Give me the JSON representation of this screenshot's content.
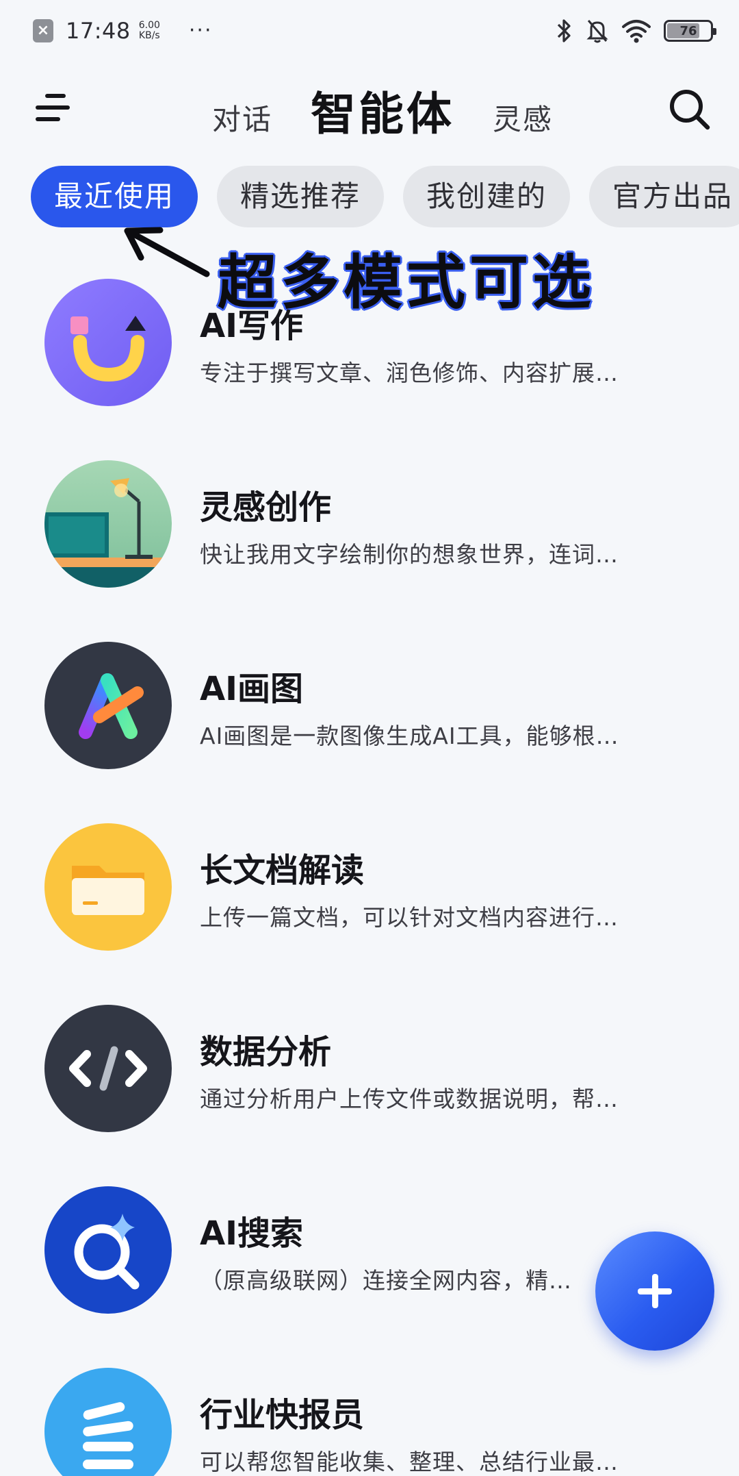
{
  "status_bar": {
    "time": "17:48",
    "net_speed_value": "6.00",
    "net_speed_unit": "KB/s",
    "more": "···",
    "battery": "76",
    "battery_level": 0.76,
    "icons": [
      "close-notification-icon",
      "bluetooth-icon",
      "mute-bell-icon",
      "wifi-icon",
      "battery-icon"
    ]
  },
  "header": {
    "tabs": [
      {
        "label": "对话",
        "active": false
      },
      {
        "label": "智能体",
        "active": true
      },
      {
        "label": "灵感",
        "active": false
      }
    ],
    "icons": [
      "menu-icon",
      "search-icon"
    ]
  },
  "chips": [
    {
      "label": "最近使用",
      "active": true
    },
    {
      "label": "精选推荐",
      "active": false
    },
    {
      "label": "我创建的",
      "active": false
    },
    {
      "label": "官方出品",
      "active": false
    }
  ],
  "annotation": {
    "text": "超多模式可选",
    "color": "#3a5ff0"
  },
  "agents": [
    {
      "title": "AI写作",
      "desc": "专注于撰写文章、润色修饰、内容扩展…",
      "icon": "writing-smile-icon"
    },
    {
      "title": "灵感创作",
      "desc": "快让我用文字绘制你的想象世界，连词…",
      "icon": "desk-lamp-scene-icon"
    },
    {
      "title": "AI画图",
      "desc": "AI画图是一款图像生成AI工具，能够根…",
      "icon": "gradient-a-logo-icon"
    },
    {
      "title": "长文档解读",
      "desc": "上传一篇文档，可以针对文档内容进行…",
      "icon": "folder-icon"
    },
    {
      "title": "数据分析",
      "desc": "通过分析用户上传文件或数据说明，帮…",
      "icon": "code-brackets-icon"
    },
    {
      "title": "AI搜索",
      "desc": "（原高级联网）连接全网内容，精…",
      "icon": "sparkle-search-icon"
    },
    {
      "title": "行业快报员",
      "desc": "可以帮您智能收集、整理、总结行业最…",
      "icon": "speed-lines-icon"
    }
  ],
  "fab": {
    "icon": "plus-icon"
  },
  "colors": {
    "accent": "#2a57ec",
    "background": "#f5f7fa",
    "chip_inactive": "#e4e6ea"
  }
}
